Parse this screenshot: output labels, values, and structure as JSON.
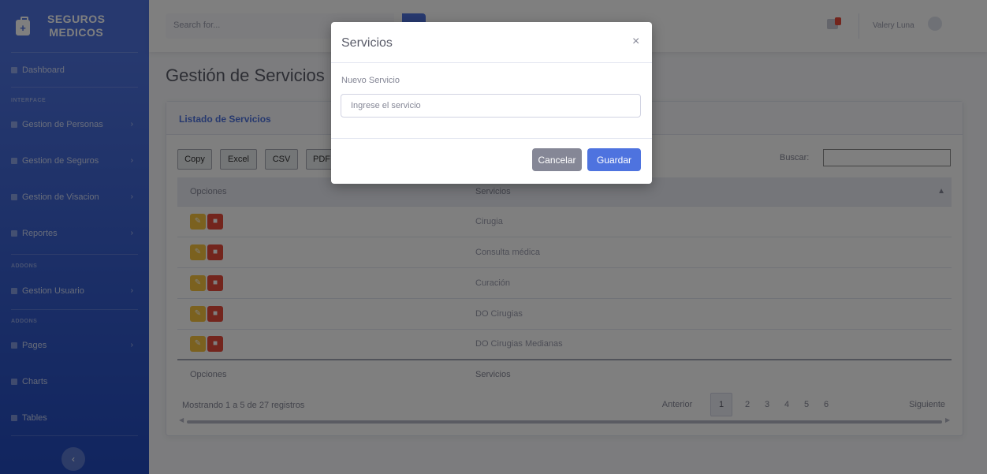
{
  "brand": {
    "line1": "SEGUROS",
    "line2": "MEDICOS",
    "icon": "briefcase-medical-icon"
  },
  "sidebar": {
    "dashboard": "Dashboard",
    "heading_interface": "INTERFACE",
    "items": [
      {
        "label": "Gestion de Personas",
        "icon": "users-icon"
      },
      {
        "label": "Gestion de Seguros",
        "icon": "file-icon"
      },
      {
        "label": "Gestion de Visacion",
        "icon": "card-icon"
      },
      {
        "label": "Reportes",
        "icon": "report-icon"
      }
    ],
    "heading_addons1": "ADDONS",
    "gestion_usuario": "Gestion Usuario",
    "heading_addons2": "ADDONS",
    "pages": "Pages",
    "charts": "Charts",
    "tables": "Tables",
    "toggle": "‹"
  },
  "topbar": {
    "search_placeholder": "Search for...",
    "user_name": "Valery Luna"
  },
  "page": {
    "title": "Gestión de Servicios"
  },
  "card": {
    "title": "Listado de Servicios",
    "buttons": [
      "Copy",
      "Excel",
      "CSV",
      "PDF"
    ],
    "search_label": "Buscar:",
    "columns": [
      "Opciones",
      "Servicios"
    ],
    "rows": [
      "Cirugia",
      "Consulta médica",
      "Curación",
      "DO Cirugias",
      "DO Cirugias Medianas"
    ],
    "info": "Mostrando 1 a 5 de 27 registros",
    "pagination": {
      "prev": "Anterior",
      "pages": [
        "1",
        "2",
        "3",
        "4",
        "5",
        "6"
      ],
      "active": "1",
      "next": "Siguiente"
    }
  },
  "modal": {
    "title": "Servicios",
    "close": "×",
    "label": "Nuevo Servicio",
    "placeholder": "Ingrese el servicio",
    "cancel": "Cancelar",
    "save": "Guardar"
  }
}
